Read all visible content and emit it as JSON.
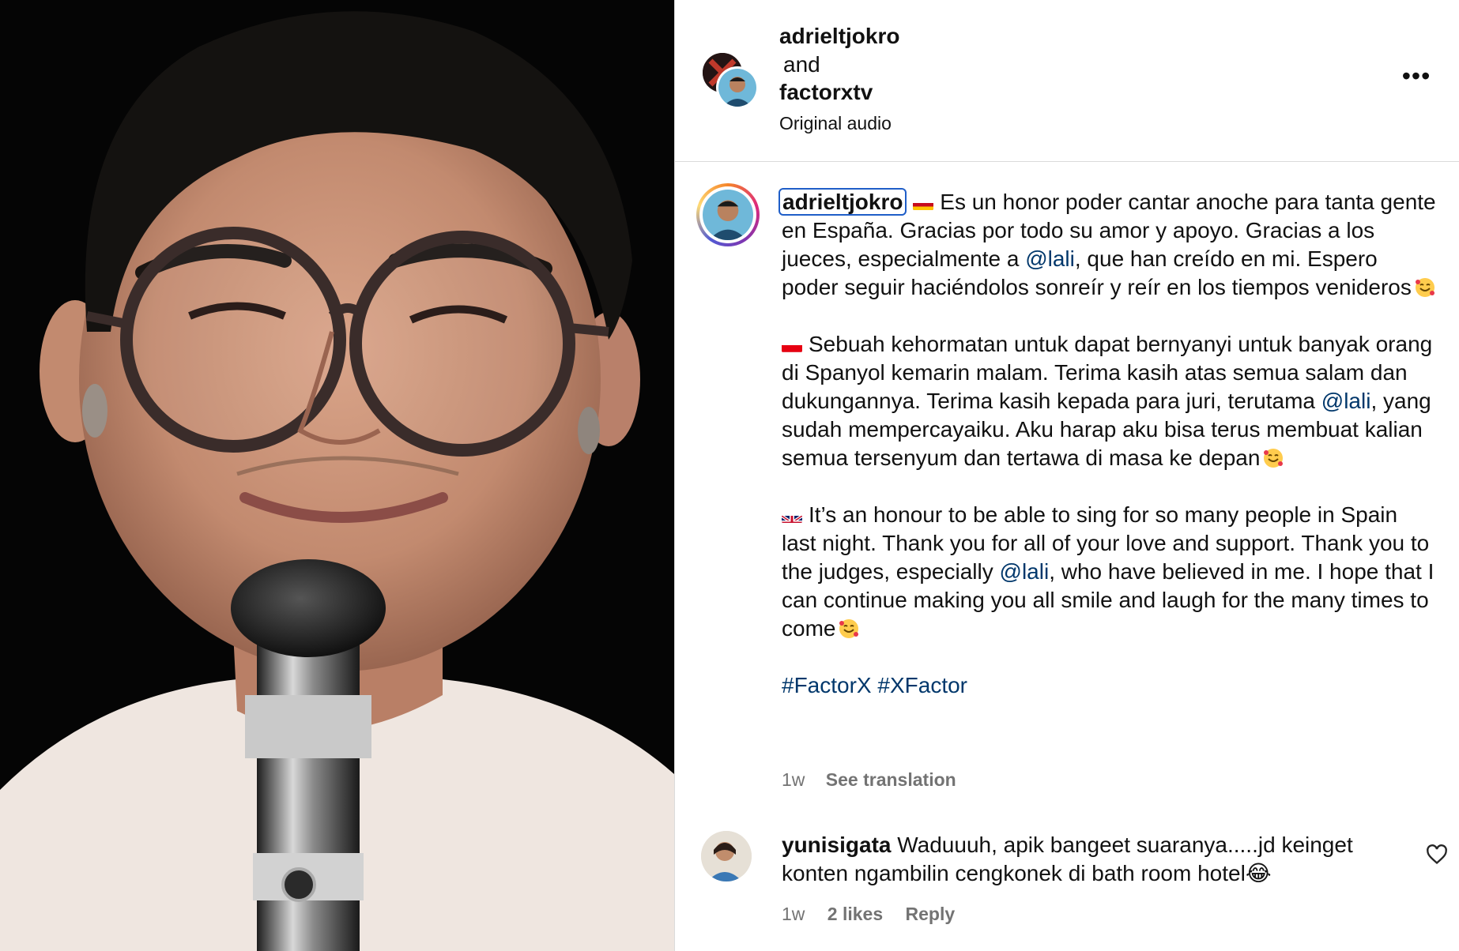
{
  "header": {
    "coauthor1": "adrieltjokro",
    "connector": "and",
    "coauthor2": "factorxtv",
    "audio": "Original audio",
    "more_label": "•••"
  },
  "caption": {
    "username": "adrieltjokro",
    "es_text_1": "Es un honor poder cantar anoche para tanta gente en España. Gracias por todo su amor y apoyo. Gracias a los jueces, especialmente a ",
    "es_mention": "@lali",
    "es_text_2": ", que han creído en mi. Espero poder seguir haciéndolos sonreír y reír en los tiempos venideros",
    "id_text_1": "Sebuah kehormatan untuk dapat bernyanyi untuk banyak orang di Spanyol kemarin malam. Terima kasih atas semua salam dan dukungannya. Terima kasih kepada para juri, terutama ",
    "id_mention": "@lali",
    "id_text_2": ", yang sudah mempercayaiku. Aku harap aku bisa terus membuat kalian semua tersenyum dan tertawa di masa ke depan",
    "en_text_1": "It’s an honour to be able to sing for so many people in Spain last night. Thank you for all of your love and support. Thank you to the judges, especially ",
    "en_mention": "@lali",
    "en_text_2": ", who have believed in me. I hope that I can continue making you all smile and laugh for the many times to come",
    "hashtag1": "#FactorX",
    "hashtag2": "#XFactor",
    "time": "1w",
    "see_translation": "See translation"
  },
  "comment": {
    "username": "yunisigata",
    "text": "Waduuuh, apik bangeet suaranya.....jd keinget konten ngambilin cengkonek di bath room hotel",
    "emoji": "😂",
    "time": "1w",
    "likes": "2 likes",
    "reply": "Reply"
  },
  "icons": {
    "more": "more-options-icon",
    "like": "heart-icon",
    "flag_es": "spain-flag-icon",
    "flag_id": "indonesia-flag-icon",
    "flag_gb": "uk-flag-icon",
    "emoji": "smiling-face-with-hearts-icon"
  },
  "colors": {
    "mention": "#00376b",
    "secondary_text": "#737373",
    "highlight_border": "#1f5ec8",
    "divider": "#dbdbdb"
  }
}
